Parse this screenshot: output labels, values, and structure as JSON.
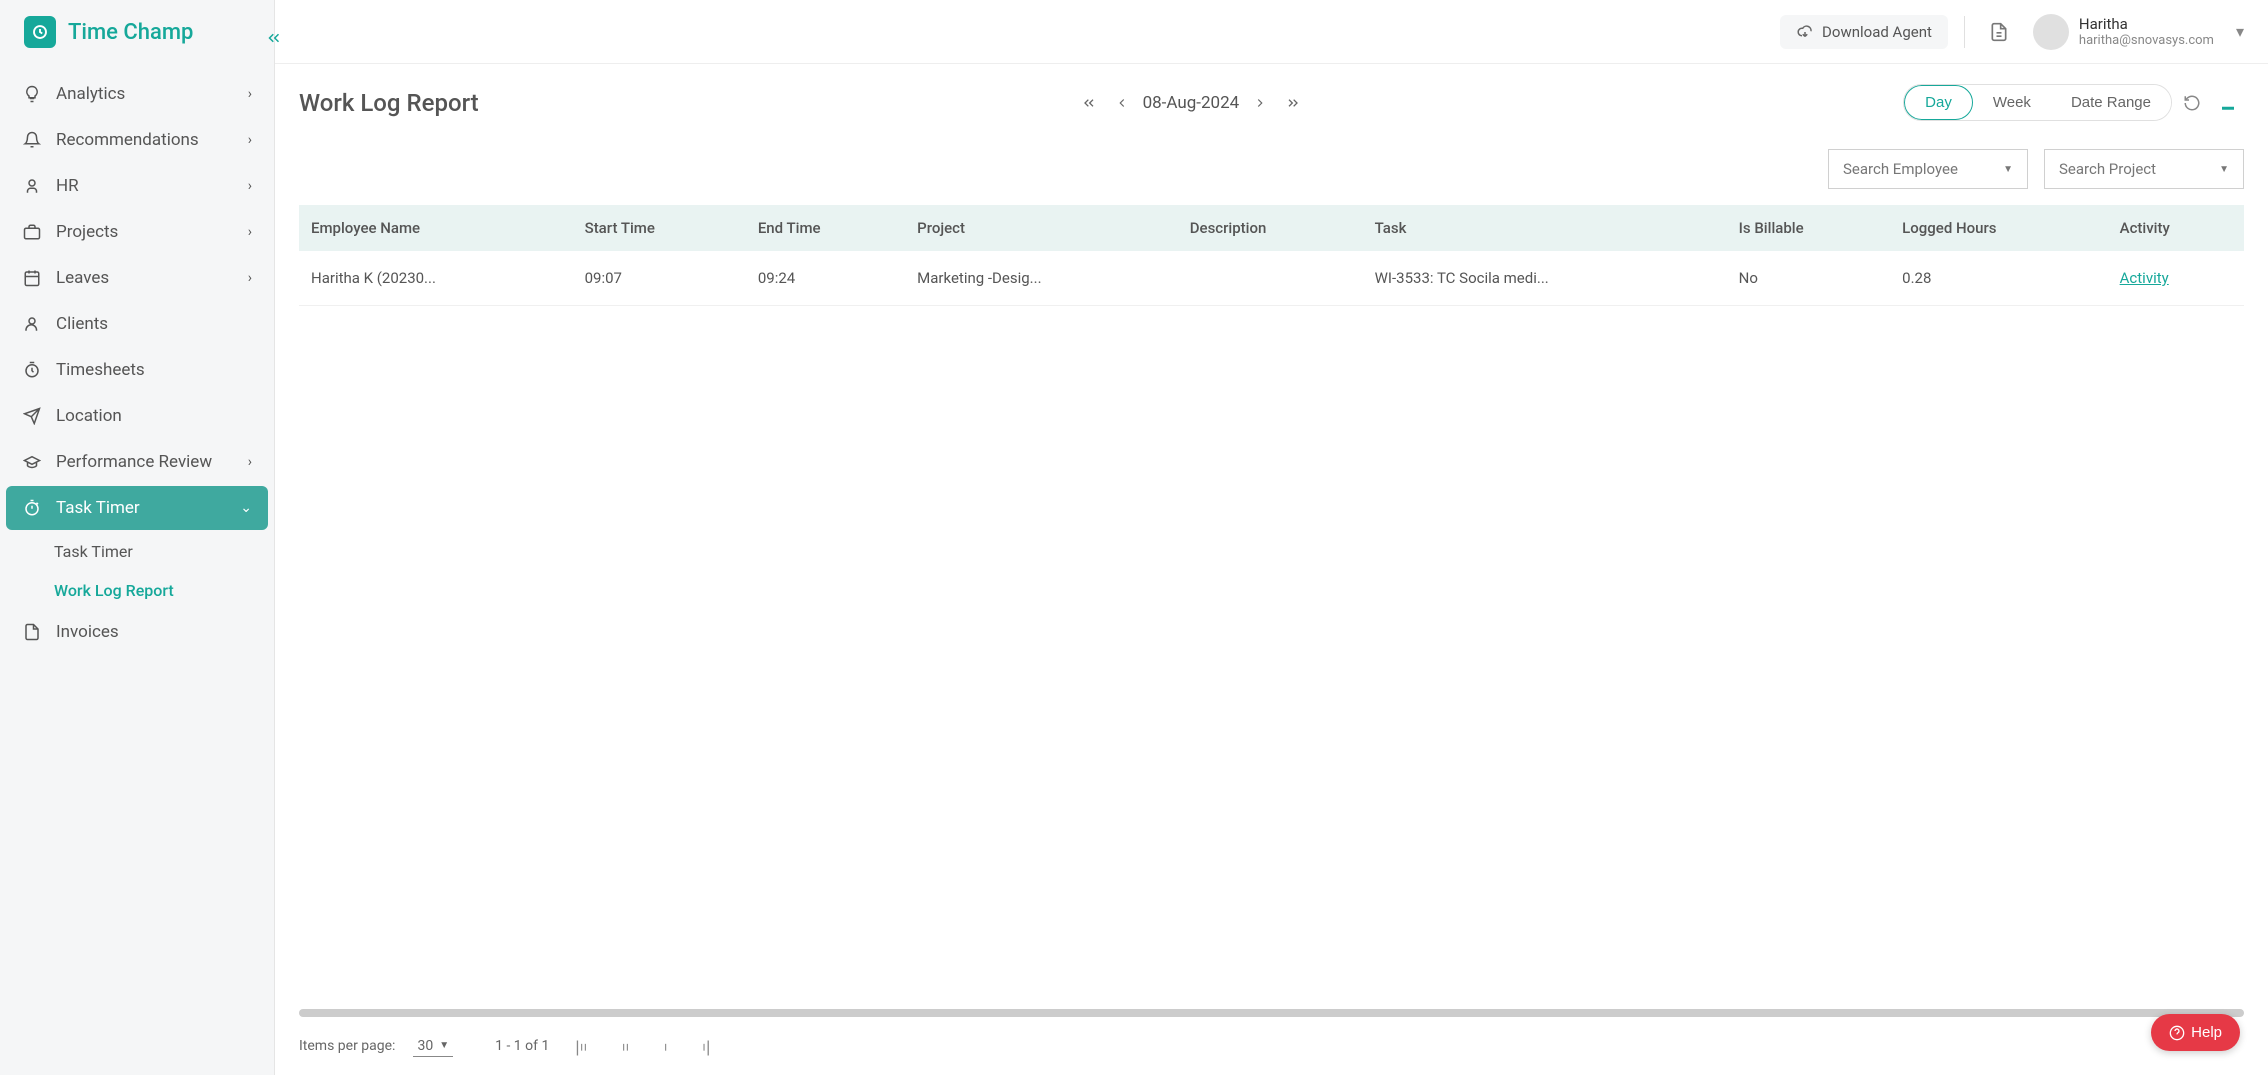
{
  "brand": "Time Champ",
  "header": {
    "download_agent": "Download Agent",
    "user_name": "Haritha",
    "user_email": "haritha@snovasys.com"
  },
  "sidebar": {
    "items": [
      {
        "label": "Analytics",
        "icon": "lightbulb",
        "expandable": true
      },
      {
        "label": "Recommendations",
        "icon": "bell",
        "expandable": true
      },
      {
        "label": "HR",
        "icon": "person",
        "expandable": true
      },
      {
        "label": "Projects",
        "icon": "briefcase",
        "expandable": true
      },
      {
        "label": "Leaves",
        "icon": "calendar",
        "expandable": true
      },
      {
        "label": "Clients",
        "icon": "user",
        "expandable": false
      },
      {
        "label": "Timesheets",
        "icon": "clock",
        "expandable": false
      },
      {
        "label": "Location",
        "icon": "send",
        "expandable": false
      },
      {
        "label": "Performance Review",
        "icon": "graduation",
        "expandable": true
      },
      {
        "label": "Task Timer",
        "icon": "stopwatch",
        "expandable": true,
        "active": true
      },
      {
        "label": "Invoices",
        "icon": "file",
        "expandable": false
      }
    ],
    "task_timer_sub": [
      {
        "label": "Task Timer"
      },
      {
        "label": "Work Log Report",
        "active": true
      }
    ]
  },
  "page": {
    "title": "Work Log Report",
    "date": "08-Aug-2024",
    "range_options": [
      "Day",
      "Week",
      "Date Range"
    ],
    "range_active": "Day"
  },
  "filters": {
    "employee_placeholder": "Search Employee",
    "project_placeholder": "Search Project"
  },
  "table": {
    "columns": [
      "Employee Name",
      "Start Time",
      "End Time",
      "Project",
      "Description",
      "Task",
      "Is Billable",
      "Logged Hours",
      "Activity"
    ],
    "rows": [
      {
        "employee": "Haritha K  (20230...",
        "start": "09:07",
        "end": "09:24",
        "project": "Marketing -Desig...",
        "description": "",
        "task": "WI-3533: TC Socila medi...",
        "billable": "No",
        "logged": "0.28",
        "activity": "Activity"
      }
    ]
  },
  "pagination": {
    "label": "Items per page:",
    "per_page": "30",
    "range": "1 - 1 of 1"
  },
  "help_label": "Help"
}
